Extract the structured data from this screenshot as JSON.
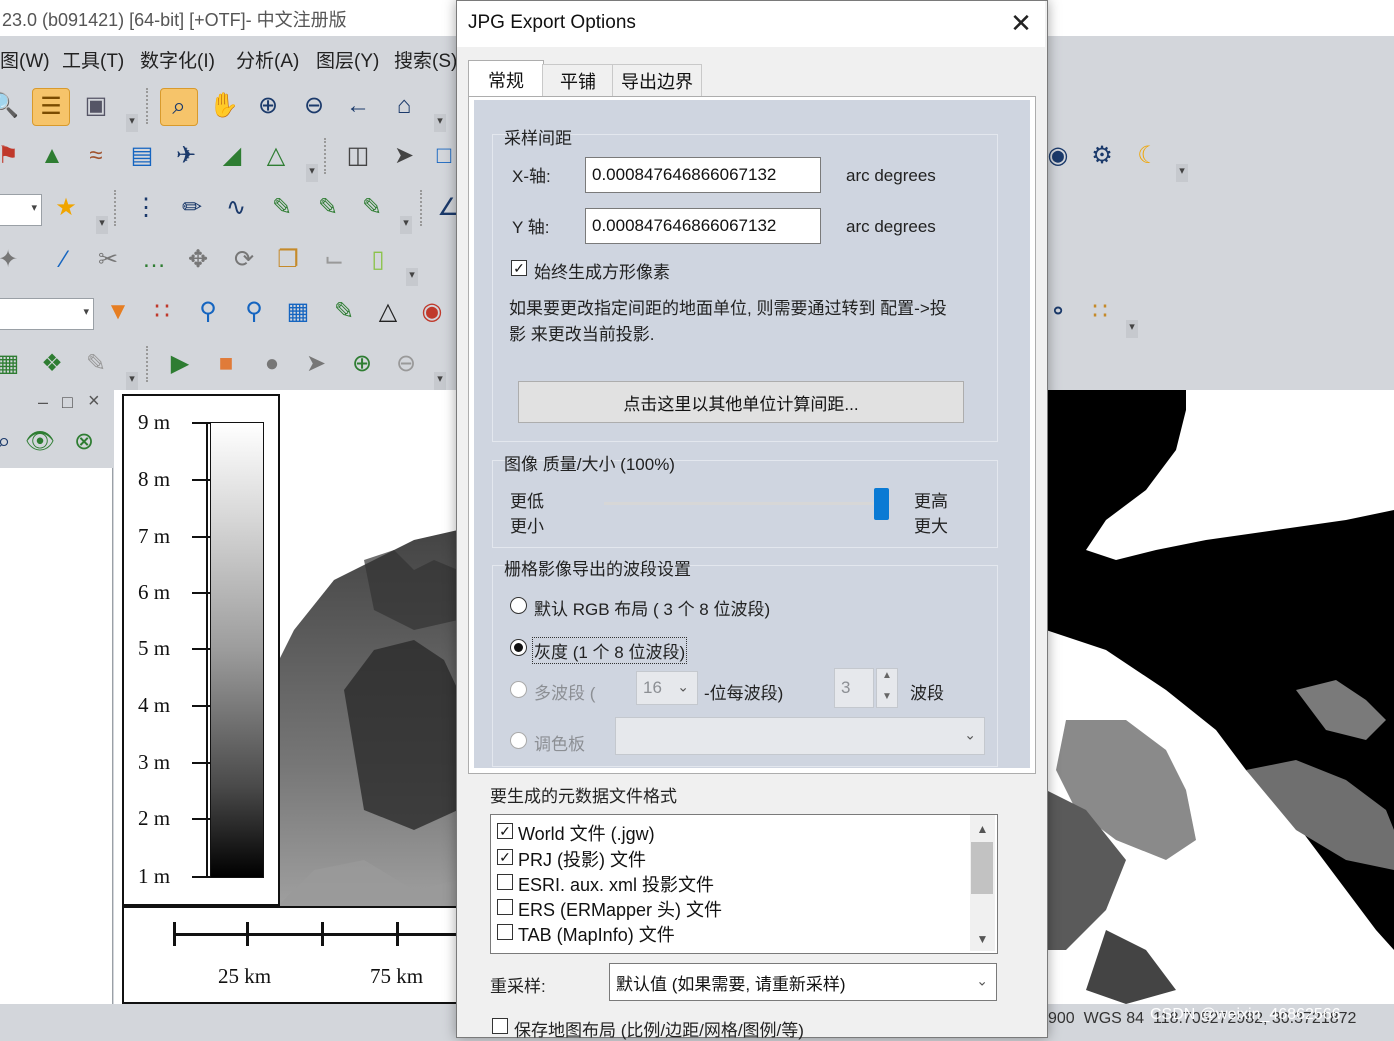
{
  "app": {
    "title": "23.0 (b091421) [64-bit] [+OTF]- 中文注册版",
    "menu": [
      "图(W)",
      "工具(T)",
      "数字化(I)",
      "分析(A)",
      "图层(Y)",
      "搜索(S)"
    ],
    "status_scale": "900",
    "status_crs": "WGS 84",
    "status_coords": "118.705272982, 30.3721872"
  },
  "legend": {
    "labels": [
      "9 m",
      "8 m",
      "7 m",
      "6 m",
      "5 m",
      "4 m",
      "3 m",
      "2 m",
      "1 m"
    ]
  },
  "scalebar": {
    "labels": [
      "25 km",
      "75 km"
    ]
  },
  "watermark": "CSDN @weixin_46862566",
  "dialog": {
    "title": "JPG Export Options",
    "tabs": [
      "常规",
      "平铺",
      "导出边界"
    ],
    "active_tab": "常规",
    "sampling": {
      "group_title": "采样间距",
      "x_label": "X-轴:",
      "x_value": "0.000847646866067132",
      "y_label": "Y 轴:",
      "y_value": "0.000847646866067132",
      "unit": "arc degrees",
      "square_pixels_label": "始终生成方形像素",
      "square_pixels_checked": true,
      "note_line1": "如果要更改指定间距的地面单位, 则需要通过转到 配置->投",
      "note_line2": "影 来更改当前投影.",
      "calc_button": "点击这里以其他单位计算间距..."
    },
    "quality": {
      "group_title": "图像 质量/大小 (100%)",
      "low_1": "更低",
      "low_2": "更小",
      "high_1": "更高",
      "high_2": "更大",
      "value_percent": 100
    },
    "bands": {
      "group_title": "栅格影像导出的波段设置",
      "option_rgb": "默认 RGB 布局 ( 3 个 8 位波段)",
      "option_gray": "灰度 (1 个 8 位波段)",
      "option_multi": "多波段 (",
      "bits_value": "16",
      "bits_suffix": "-位每波段)",
      "band_count": "3",
      "band_suffix": "波段",
      "option_palette": "调色板",
      "selected": "灰度"
    },
    "metadata": {
      "title": "要生成的元数据文件格式",
      "items": [
        {
          "label": "World 文件 (.jgw)",
          "checked": true
        },
        {
          "label": "PRJ (投影) 文件",
          "checked": true
        },
        {
          "label": "ESRI. aux. xml 投影文件",
          "checked": false
        },
        {
          "label": "ERS (ERMapper 头) 文件",
          "checked": false
        },
        {
          "label": "TAB (MapInfo) 文件",
          "checked": false
        }
      ]
    },
    "resample": {
      "label": "重采样:",
      "value": "默认值 (如果需要, 请重新采样)"
    },
    "save_layout_label": "保存地图布局 (比例/边距/网格/图例/等)"
  },
  "colors": {
    "accent": "#0a7ad4",
    "dialog_panel": "#cfd5e0",
    "app_chrome": "#d3d6db"
  }
}
